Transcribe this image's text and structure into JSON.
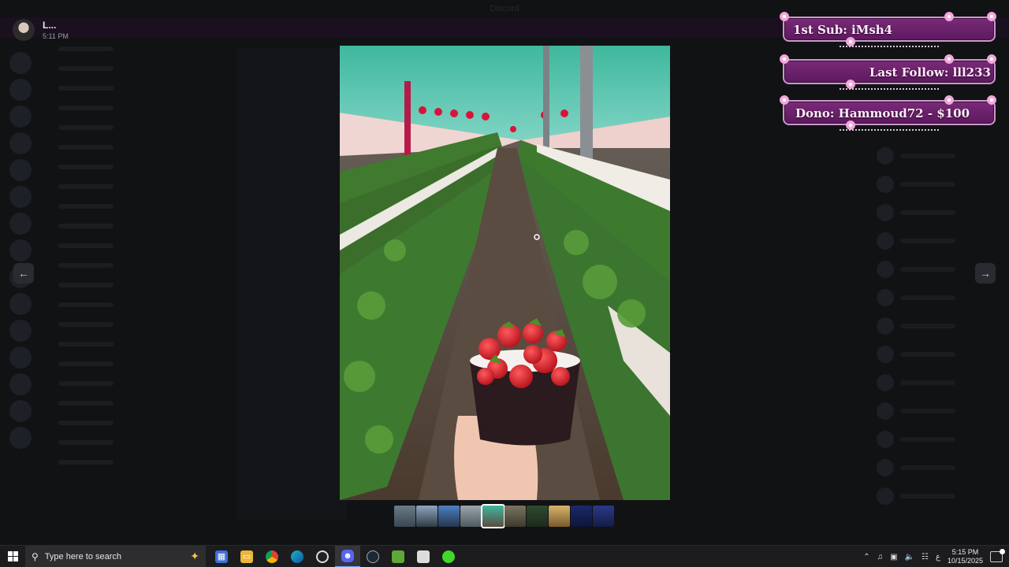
{
  "window": {
    "title": "Discord"
  },
  "viewer": {
    "username": "L...",
    "timestamp": "5:11 PM",
    "prev_icon": "arrow-left-icon",
    "next_icon": "arrow-right-icon",
    "thumbnail_count": 10,
    "active_thumbnail": 5
  },
  "overlays": {
    "first_sub": "1st Sub: iMsh4",
    "last_follow": "Last Follow: lll233",
    "dono": "Dono: Hammoud72 - $100",
    "colors": {
      "fill": "#6a2268",
      "border": "#c99ac7",
      "accent": "#f2a8da"
    }
  },
  "taskbar": {
    "search_placeholder": "Type here to search",
    "apps": [
      "file-explorer-icon",
      "chrome-icon",
      "edge-icon",
      "obs-icon",
      "discord-icon",
      "steam-icon",
      "minecraft-icon",
      "box-icon",
      "razer-icon"
    ],
    "time": "5:15 PM",
    "date": "10/15/2025",
    "input_indicator": "ع"
  }
}
